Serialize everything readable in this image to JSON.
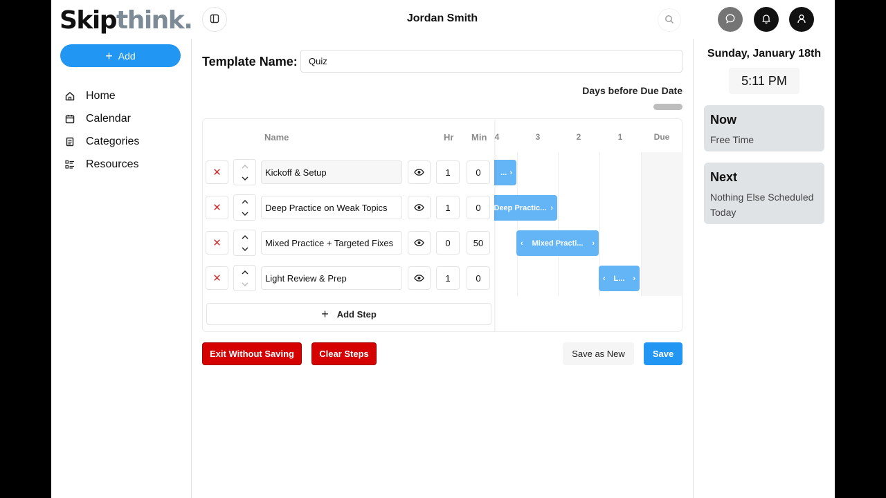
{
  "brand": {
    "part1": "Skip",
    "part2": "think."
  },
  "sidebar": {
    "add_label": "Add",
    "items": [
      {
        "label": "Home",
        "icon": "home-icon"
      },
      {
        "label": "Calendar",
        "icon": "calendar-icon"
      },
      {
        "label": "Categories",
        "icon": "document-icon"
      },
      {
        "label": "Resources",
        "icon": "checklist-icon"
      }
    ]
  },
  "header": {
    "user_name": "Jordan Smith"
  },
  "template": {
    "name_label": "Template Name:",
    "name_value": "Quiz",
    "days_label": "Days before Due Date",
    "columns": {
      "name": "Name",
      "hr": "Hr",
      "min": "Min"
    },
    "day_headers": [
      "4",
      "3",
      "2",
      "1",
      "Due"
    ],
    "steps": [
      {
        "name": "Kickoff & Setup",
        "hr": "1",
        "min": "0",
        "bar_label": "...",
        "bar_start_day": 4,
        "bar_visible_from": "clipped"
      },
      {
        "name": "Deep Practice on Weak Topics",
        "hr": "1",
        "min": "0",
        "bar_label": "Deep Practic...",
        "bar_start_day": 3
      },
      {
        "name": "Mixed Practice + Targeted Fixes",
        "hr": "0",
        "min": "50",
        "bar_label": "Mixed Practi...",
        "bar_start_day": 2
      },
      {
        "name": "Light Review & Prep",
        "hr": "1",
        "min": "0",
        "bar_label": "L...",
        "bar_start_day": 1
      }
    ],
    "add_step_label": "Add Step"
  },
  "actions": {
    "exit_label": "Exit Without Saving",
    "clear_label": "Clear Steps",
    "save_new_label": "Save as New",
    "save_label": "Save"
  },
  "right_panel": {
    "date": "Sunday, January 18th",
    "time": "5:11 PM",
    "now_title": "Now",
    "now_text": "Free Time",
    "next_title": "Next",
    "next_text": "Nothing Else Scheduled Today"
  },
  "colors": {
    "accent": "#2196f3",
    "danger": "#d50000",
    "bar": "#64b5f6",
    "card": "#dfe3e6"
  }
}
